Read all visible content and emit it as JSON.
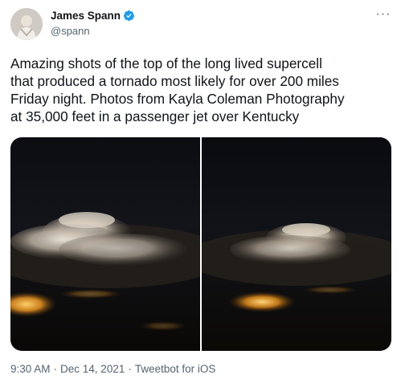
{
  "author": {
    "name": "James Spann",
    "handle": "@spann",
    "verified": true
  },
  "icons": {
    "avatar": "avatar",
    "verified": "verified-badge-icon",
    "more": "more-options-icon"
  },
  "more_label": "···",
  "tweet": {
    "text": "Amazing shots of the top of the long lived supercell\nthat produced a tornado most likely for over 200 miles\nFriday night. Photos from Kayla Coleman Photography\nat 35,000 feet in a passenger jet over Kentucky"
  },
  "meta": {
    "time": "9:30 AM",
    "separator": "·",
    "date": "Dec 14, 2021",
    "source": "Tweetbot for iOS"
  },
  "colors": {
    "verified": "#1d9bf0",
    "text": "#0f1419",
    "muted": "#536471"
  }
}
